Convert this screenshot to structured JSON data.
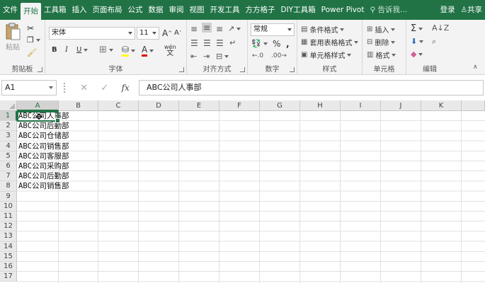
{
  "tabs": [
    "文件",
    "开始",
    "工具箱",
    "插入",
    "页面布局",
    "公式",
    "数据",
    "审阅",
    "视图",
    "开发工具",
    "方方格子",
    "DIY工具箱",
    "Power Pivot"
  ],
  "active_tab": "开始",
  "tell_me": "告诉我...",
  "login": "登录",
  "share": "共享",
  "ribbon": {
    "clipboard": {
      "paste": "粘贴",
      "label": "剪贴板"
    },
    "font": {
      "name": "宋体",
      "size": "11",
      "bold": "B",
      "italic": "I",
      "underline": "U",
      "grow": "A",
      "shrink": "A",
      "wen": "wén",
      "label": "字体"
    },
    "align": {
      "label": "对齐方式"
    },
    "number": {
      "format": "常规",
      "percent": "%",
      "comma": ",",
      "label": "数字"
    },
    "styles": {
      "cond": "条件格式",
      "table": "套用表格格式",
      "cell": "单元格样式",
      "label": "样式"
    },
    "cells": {
      "insert": "插入",
      "delete": "删除",
      "format": "格式",
      "label": "单元格"
    },
    "edit": {
      "label": "编辑"
    }
  },
  "formula_bar": {
    "name_box": "A1",
    "cancel": "✕",
    "enter": "✓",
    "fx": "fx",
    "value": "ABC公司人事部"
  },
  "columns": [
    "A",
    "B",
    "C",
    "D",
    "E",
    "F",
    "G",
    "H",
    "I",
    "J",
    "K"
  ],
  "rows": [
    "1",
    "2",
    "3",
    "4",
    "5",
    "6",
    "7",
    "8",
    "9",
    "10",
    "11",
    "12",
    "13",
    "14",
    "15",
    "16",
    "17"
  ],
  "cells_A": [
    "ABC公司人事部",
    "ABC公司后勤部",
    "ABC公司仓储部",
    "ABC公司销售部",
    "ABC公司客服部",
    "ABC公司采购部",
    "ABC公司后勤部",
    "ABC公司销售部"
  ],
  "colors": {
    "accent": "#217346",
    "ribbon_bg": "#f3f3f3"
  }
}
